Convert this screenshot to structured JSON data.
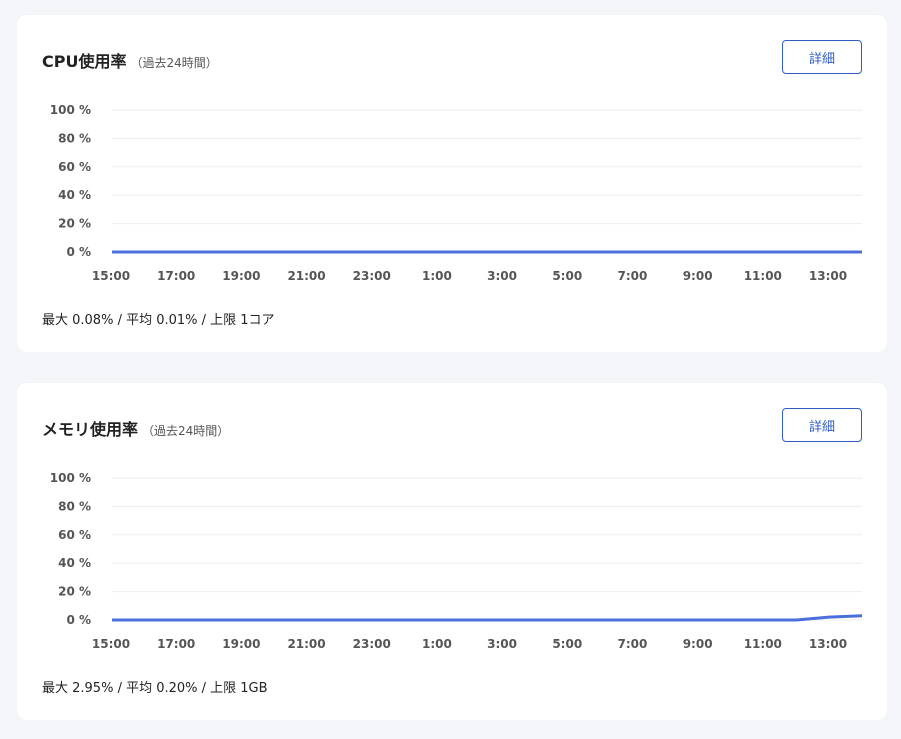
{
  "cpu": {
    "title": "CPU使用率",
    "subtitle": "（過去24時間）",
    "detail_label": "詳細",
    "stats_text": "最大 0.08% / 平均 0.01% / 上限 1コア"
  },
  "memory": {
    "title": "メモリ使用率",
    "subtitle": "（過去24時間）",
    "detail_label": "詳細",
    "stats_text": "最大 2.95% / 平均 0.20% / 上限 1GB"
  },
  "colors": {
    "line": "#4a6fdc",
    "accent": "#2f5dc4",
    "grid": "#eeeeee"
  },
  "chart_data": [
    {
      "type": "line",
      "y_ticks": [
        "100 %",
        "80 %",
        "60 %",
        "40 %",
        "20 %",
        "0 %"
      ],
      "x_ticks": [
        "15:00",
        "17:00",
        "19:00",
        "21:00",
        "23:00",
        "1:00",
        "3:00",
        "5:00",
        "7:00",
        "9:00",
        "11:00",
        "13:00"
      ],
      "ylim": [
        0,
        100
      ],
      "grid": true,
      "series": [
        {
          "x": [
            "15:00",
            "13:00",
            "14:00"
          ],
          "values": [
            0.01,
            0.01,
            0.01
          ]
        }
      ]
    },
    {
      "type": "line",
      "y_ticks": [
        "100 %",
        "80 %",
        "60 %",
        "40 %",
        "20 %",
        "0 %"
      ],
      "x_ticks": [
        "15:00",
        "17:00",
        "19:00",
        "21:00",
        "23:00",
        "1:00",
        "3:00",
        "5:00",
        "7:00",
        "9:00",
        "11:00",
        "13:00"
      ],
      "ylim": [
        0,
        100
      ],
      "grid": true,
      "series": [
        {
          "x": [
            "15:00",
            "12:00",
            "13:00",
            "14:00"
          ],
          "values": [
            0.0,
            0.0,
            2.0,
            2.95
          ]
        }
      ]
    }
  ]
}
